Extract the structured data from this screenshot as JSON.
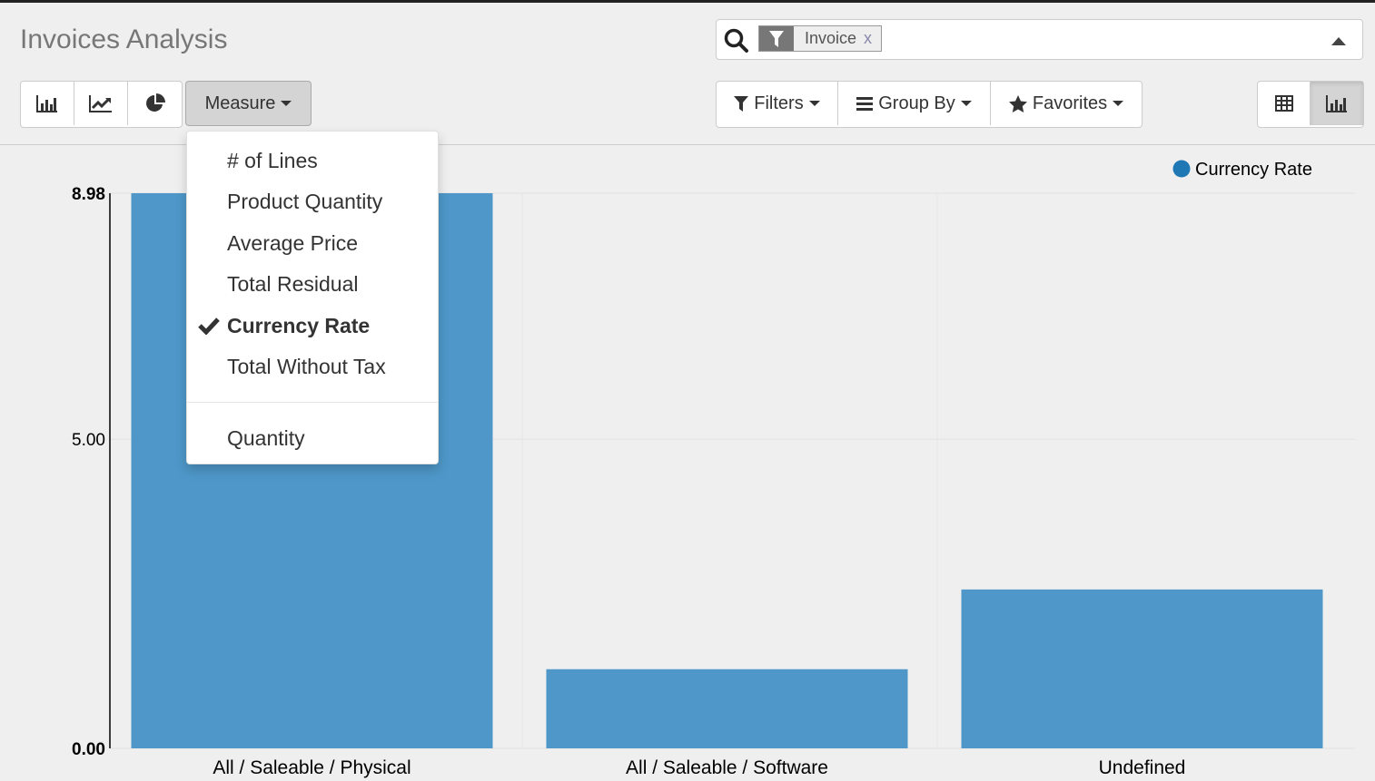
{
  "header": {
    "title": "Invoices Analysis"
  },
  "view_type_buttons": [
    {
      "icon": "bar-chart-icon",
      "label": "Bar Chart"
    },
    {
      "icon": "line-chart-icon",
      "label": "Line Chart"
    },
    {
      "icon": "pie-chart-icon",
      "label": "Pie Chart"
    }
  ],
  "measure": {
    "label": "Measure",
    "items": [
      {
        "label": "# of Lines",
        "selected": false
      },
      {
        "label": "Product Quantity",
        "selected": false
      },
      {
        "label": "Average Price",
        "selected": false
      },
      {
        "label": "Total Residual",
        "selected": false
      },
      {
        "label": "Currency Rate",
        "selected": true
      },
      {
        "label": "Total Without Tax",
        "selected": false
      }
    ],
    "extra_items": [
      {
        "label": "Quantity",
        "selected": false
      }
    ]
  },
  "search": {
    "placeholder": "",
    "facets": [
      {
        "icon": "filter-icon",
        "value": "Invoice",
        "remove": "x"
      }
    ]
  },
  "search_options": {
    "filters": "Filters",
    "group_by": "Group By",
    "favorites": "Favorites"
  },
  "view_switcher": [
    {
      "icon": "table-icon",
      "label": "Pivot",
      "active": false
    },
    {
      "icon": "bar-chart-icon",
      "label": "Graph",
      "active": true
    }
  ],
  "colors": {
    "bar": "#4e97c8",
    "legend": "#1f77b4"
  },
  "chart_data": {
    "type": "bar",
    "categories": [
      "All / Saleable / Physical",
      "All / Saleable / Software",
      "Undefined"
    ],
    "series": [
      {
        "name": "Currency Rate",
        "values": [
          8.98,
          1.28,
          2.57
        ]
      }
    ],
    "yticks": [
      "0.00",
      "5.00",
      "8.98"
    ],
    "ylim": [
      0,
      8.98
    ],
    "xlabel": "",
    "ylabel": "",
    "title": "",
    "legend": "top-right",
    "grid": true
  }
}
